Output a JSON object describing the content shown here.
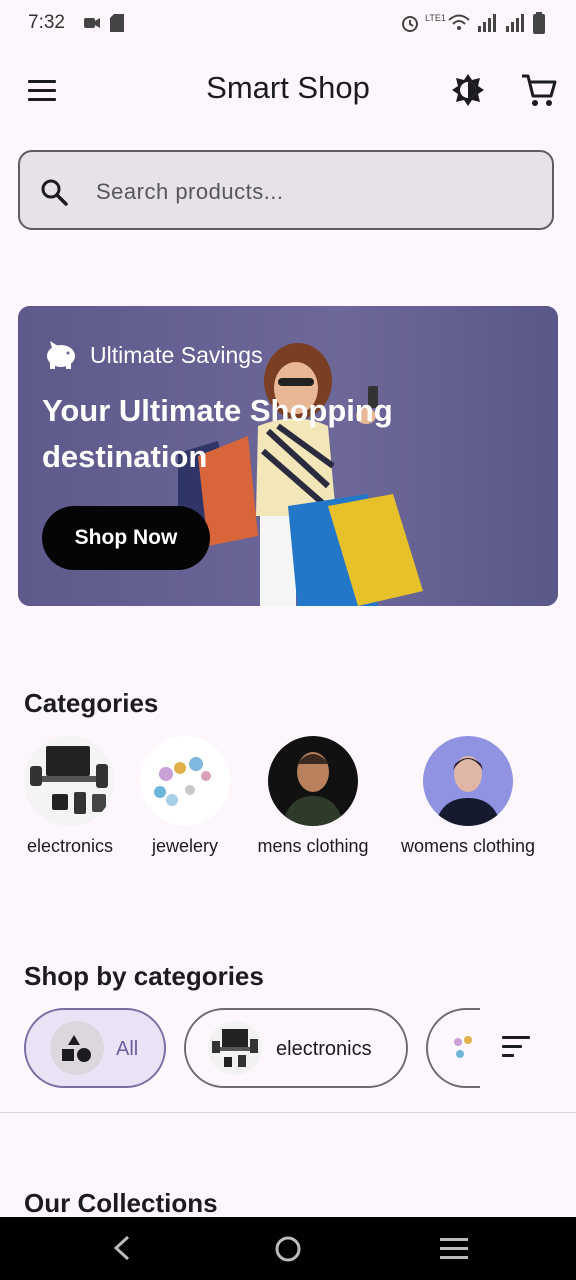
{
  "status_bar": {
    "time": "7:32",
    "network": "LTE1"
  },
  "app_bar": {
    "title": "Smart Shop",
    "menu_icon": "menu-icon",
    "theme_icon": "brightness-icon",
    "cart_icon": "cart-icon"
  },
  "search": {
    "placeholder": "Search products..."
  },
  "banner": {
    "tag": "Ultimate Savings",
    "heading": "Your Ultimate Shopping destination",
    "button_label": "Shop Now"
  },
  "categories": {
    "title": "Categories",
    "items": [
      {
        "label": "electronics"
      },
      {
        "label": "jewelery"
      },
      {
        "label": "mens clothing"
      },
      {
        "label": "womens clothing"
      }
    ]
  },
  "shop_by": {
    "title": "Shop by categories",
    "chips": [
      {
        "label": "All",
        "selected": true
      },
      {
        "label": "electronics",
        "selected": false
      }
    ]
  },
  "collections": {
    "title": "Our Collections"
  },
  "colors": {
    "background": "#fdf7fd",
    "banner": "#6a6496",
    "accent": "#7a6fa4",
    "button": "#050505"
  }
}
